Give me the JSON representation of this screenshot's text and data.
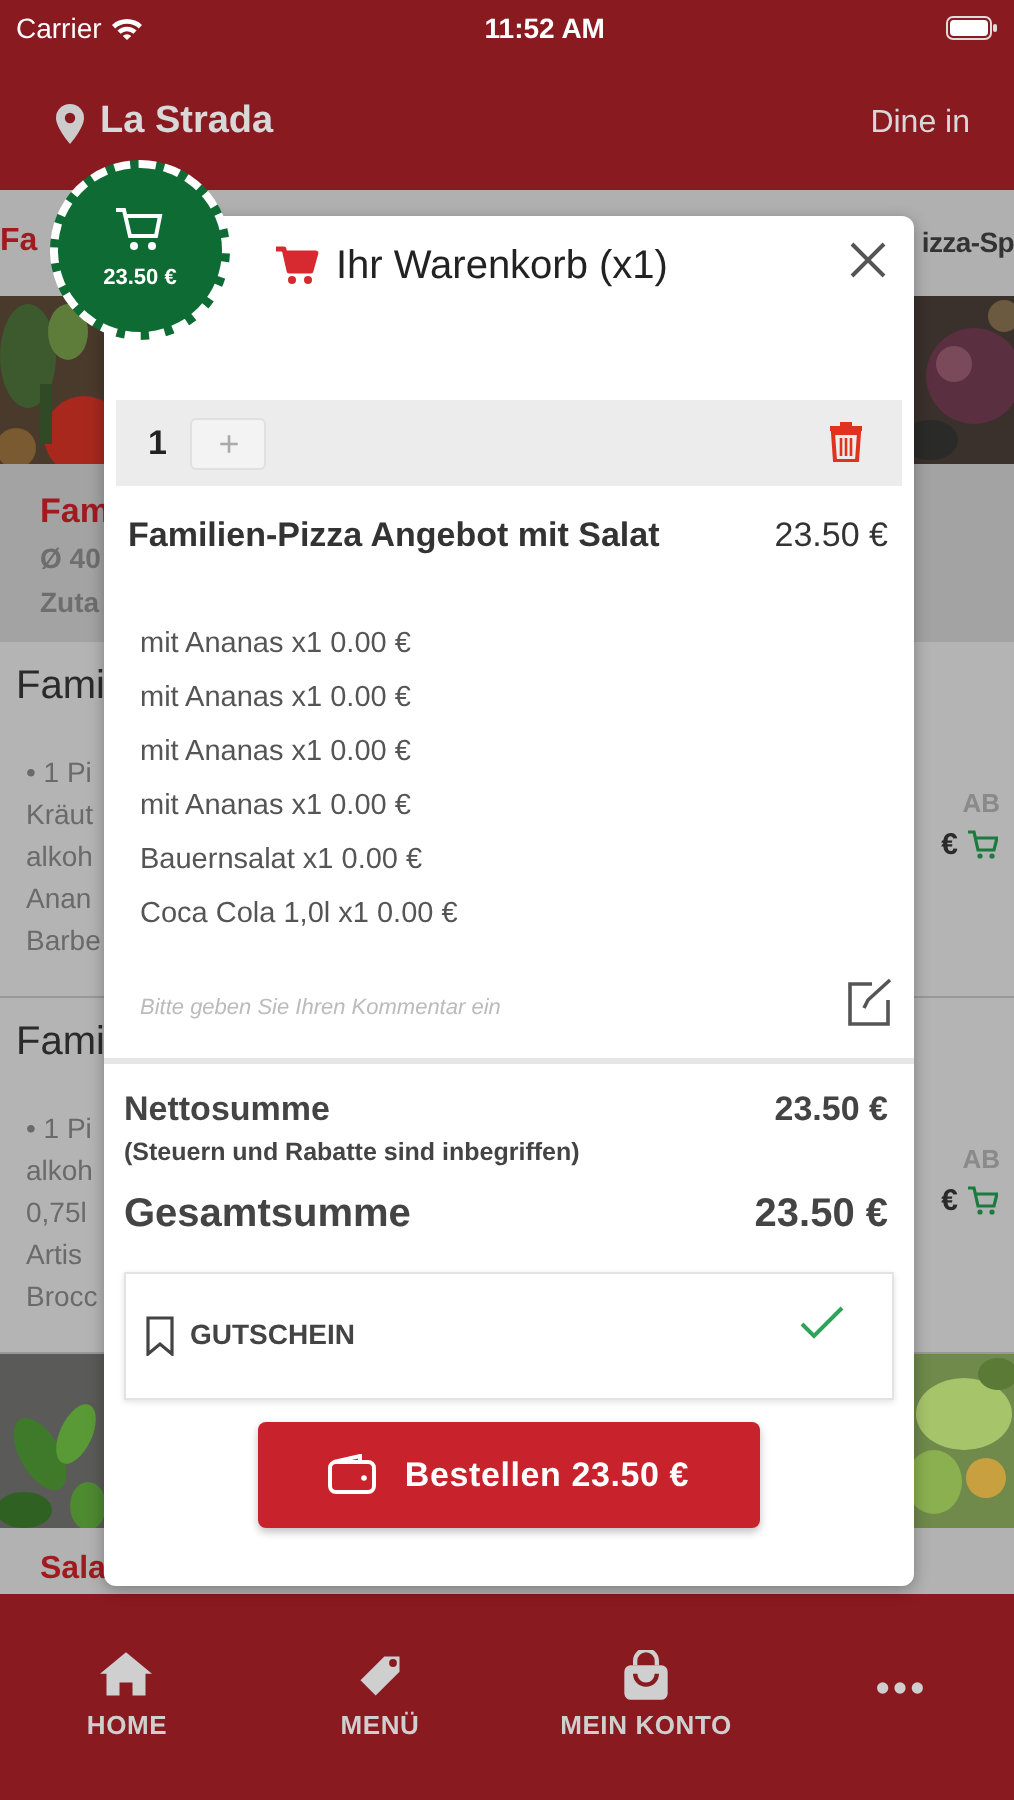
{
  "status_bar": {
    "carrier": "Carrier",
    "time": "11:52 AM"
  },
  "header": {
    "location": "La Strada",
    "mode": "Dine in"
  },
  "background_menu": {
    "category_left": "Fa",
    "category_right": "izza-Sp",
    "featured": {
      "title": "Fam",
      "size": "Ø 40",
      "ingredients": "Zuta"
    },
    "items": [
      {
        "title": "Fami",
        "lines": [
          "• 1 Pi",
          "Kräut",
          "alkoh",
          "Anan",
          "Barbe"
        ],
        "price_label": "AB",
        "price": "€"
      },
      {
        "title": "Fami",
        "lines": [
          "• 1 Pi",
          "alkoh",
          "0,75l",
          "Artis",
          "Brocc"
        ],
        "price_label": "AB",
        "price": "€"
      }
    ],
    "section": "Sala"
  },
  "cart_badge": {
    "total": "23.50 €"
  },
  "cart": {
    "title": "Ihr Warenkorb (x1)",
    "quantity": "1",
    "plus": "+",
    "item": {
      "name": "Familien-Pizza Angebot mit Salat",
      "price": "23.50 €"
    },
    "options": [
      "mit Ananas x1 0.00 €",
      "mit Ananas x1 0.00 €",
      "mit Ananas x1 0.00 €",
      "mit Ananas x1 0.00 €",
      "Bauernsalat x1 0.00 €",
      "Coca Cola 1,0l x1 0.00 €"
    ],
    "comment_placeholder": "Bitte geben Sie Ihren Kommentar ein",
    "net_label": "Nettosumme",
    "net_value": "23.50 €",
    "tax_note": "(Steuern und Rabatte sind inbegriffen)",
    "total_label": "Gesamtsumme",
    "total_value": "23.50 €",
    "voucher": {
      "label": "GUTSCHEIN",
      "applied": true
    },
    "order_button": "Bestellen 23.50 €"
  },
  "tab_bar": [
    {
      "kind": "home",
      "label": "HOME"
    },
    {
      "kind": "tag",
      "label": "MENÜ"
    },
    {
      "kind": "bag",
      "label": "MEIN KONTO"
    },
    {
      "kind": "more"
    }
  ]
}
